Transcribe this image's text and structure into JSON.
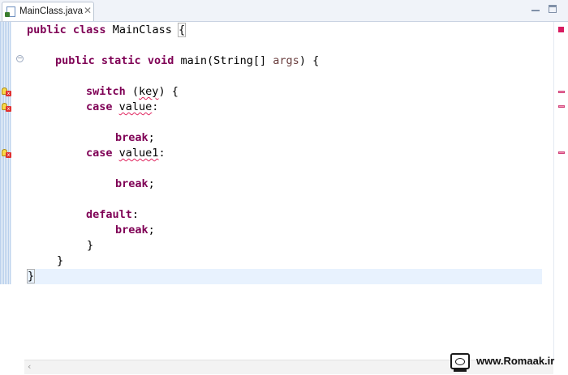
{
  "editor": {
    "tab_label": "MainClass.java",
    "tab_close": "✕"
  },
  "code": {
    "l1": {
      "k1": "public",
      "k2": "class",
      "name": "MainClass",
      "brace": "{"
    },
    "l3": {
      "k1": "public",
      "k2": "static",
      "k3": "void",
      "name": "main(String[] ",
      "param": "args",
      "rest": ") {"
    },
    "l5": {
      "k1": "switch",
      "pre": " (",
      "err": "key",
      "post": ") {"
    },
    "l6": {
      "k1": "case",
      "err": "value",
      "post": ":"
    },
    "l8": {
      "k1": "break",
      "post": ";"
    },
    "l9": {
      "k1": "case",
      "err": "value1",
      "post": ":"
    },
    "l11": {
      "k1": "break",
      "post": ";"
    },
    "l13": {
      "k1": "default",
      "post": ":"
    },
    "l14": {
      "k1": "break",
      "post": ";"
    },
    "l15": {
      "text": "}"
    },
    "l16": {
      "text": "}"
    },
    "l17": {
      "text": "}"
    }
  },
  "watermark": {
    "text": "www.Romaak.ir"
  },
  "colors": {
    "keyword": "#7f0055",
    "parameter": "#6a3e3e",
    "error_underline": "#e0245e",
    "current_line": "#e8f2fe"
  }
}
